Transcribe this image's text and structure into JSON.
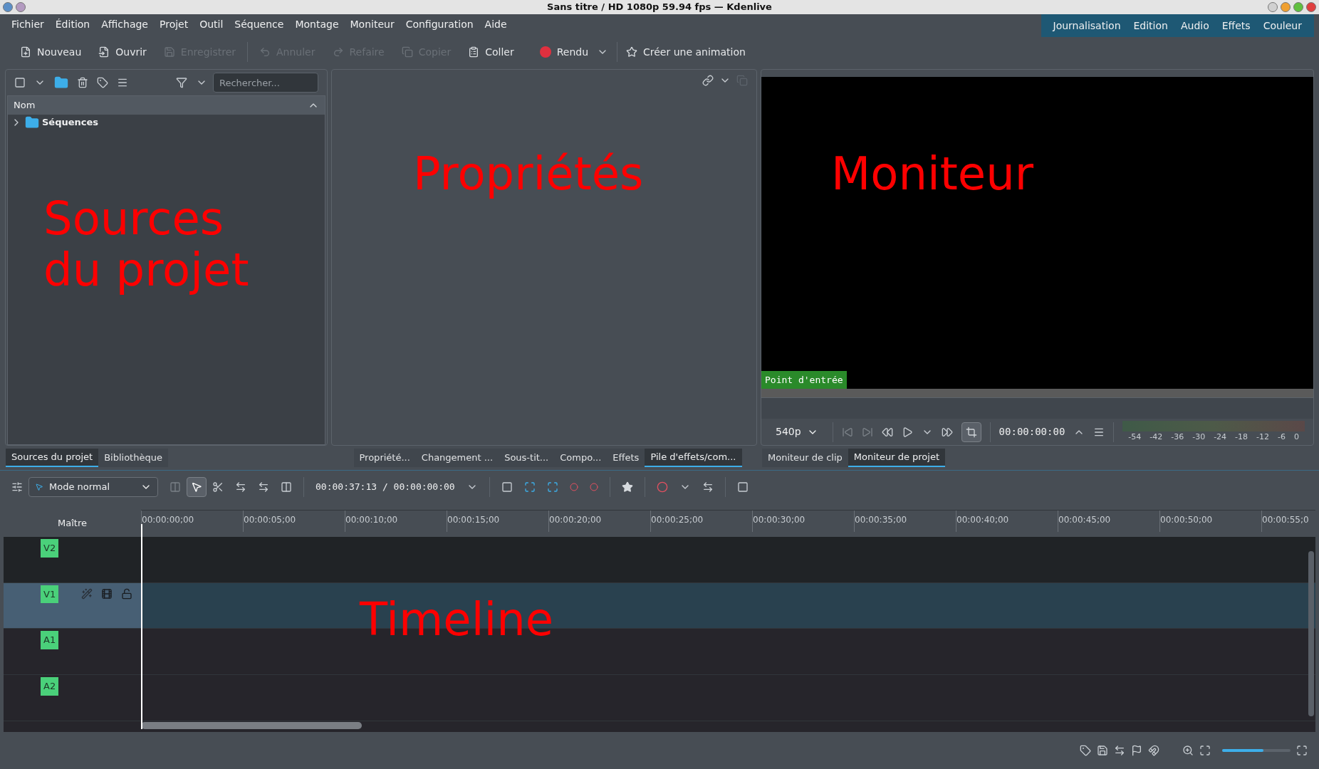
{
  "window": {
    "title": "Sans titre / HD 1080p 59.94 fps — Kdenlive"
  },
  "menu": [
    "Fichier",
    "Édition",
    "Affichage",
    "Projet",
    "Outil",
    "Séquence",
    "Montage",
    "Moniteur",
    "Configuration",
    "Aide"
  ],
  "workspaces": [
    {
      "label": "Journalisation",
      "selected": false
    },
    {
      "label": "Edition",
      "selected": false
    },
    {
      "label": "Audio",
      "selected": false
    },
    {
      "label": "Effets",
      "selected": false
    },
    {
      "label": "Couleur",
      "selected": false
    }
  ],
  "toolbar": [
    {
      "kind": "new",
      "label": "Nouveau",
      "disabled": false
    },
    {
      "kind": "open",
      "label": "Ouvrir",
      "disabled": false
    },
    {
      "kind": "save",
      "label": "Enregistrer",
      "disabled": true
    },
    {
      "kind": "undo",
      "label": "Annuler",
      "disabled": true
    },
    {
      "kind": "redo",
      "label": "Refaire",
      "disabled": true
    },
    {
      "kind": "copy",
      "label": "Copier",
      "disabled": true
    },
    {
      "kind": "paste",
      "label": "Coller",
      "disabled": false
    },
    {
      "kind": "render",
      "label": "Rendu",
      "disabled": false
    },
    {
      "kind": "animation",
      "label": "Créer une animation",
      "disabled": false
    }
  ],
  "project_bin": {
    "search": {
      "placeholder": "Rechercher..."
    },
    "column": "Nom",
    "items": [
      {
        "name": "Séquences",
        "expanded": false
      }
    ],
    "annotation": [
      "Sources",
      "du projet"
    ]
  },
  "properties": {
    "annotation": "Propriétés"
  },
  "monitor": {
    "annotation": "Moniteur",
    "marker": "Point d'entrée",
    "resolution": "540p",
    "timecode": "00:00:00:00",
    "meter_labels": [
      "-54",
      "-42",
      "-36",
      "-30",
      "-24",
      "-18",
      "-12",
      "-6",
      "0"
    ]
  },
  "dock_tabs": {
    "left": [
      {
        "label": "Sources du projet",
        "selected": true
      },
      {
        "label": "Bibliothèque",
        "selected": false
      }
    ],
    "middle": [
      {
        "label": "Propriété...",
        "selected": false
      },
      {
        "label": "Changement ...",
        "selected": false
      },
      {
        "label": "Sous-tit...",
        "selected": false
      },
      {
        "label": "Compo...",
        "selected": false
      },
      {
        "label": "Effets",
        "selected": false
      },
      {
        "label": "Pile d'effets/com...",
        "selected": true
      }
    ],
    "right": [
      {
        "label": "Moniteur de clip",
        "selected": false
      },
      {
        "label": "Moniteur de projet",
        "selected": true
      }
    ]
  },
  "timeline": {
    "mode": "Mode normal",
    "timecode": "00:00:37:13 / 00:00:00:00",
    "master": "Maître",
    "ruler": [
      "00:00:00;00",
      "00:00:05;00",
      "00:00:10;00",
      "00:00:15;00",
      "00:00:20;00",
      "00:00:25;00",
      "00:00:30;00",
      "00:00:35;00",
      "00:00:40;00",
      "00:00:45;00",
      "00:00:50;00",
      "00:00:55;0"
    ],
    "tracks": [
      {
        "name": "V2",
        "selected": false
      },
      {
        "name": "V1",
        "selected": true
      },
      {
        "name": "A1",
        "selected": false
      },
      {
        "name": "A2",
        "selected": false
      }
    ],
    "annotation": "Timeline",
    "zoom": {
      "level": 0.6
    }
  }
}
